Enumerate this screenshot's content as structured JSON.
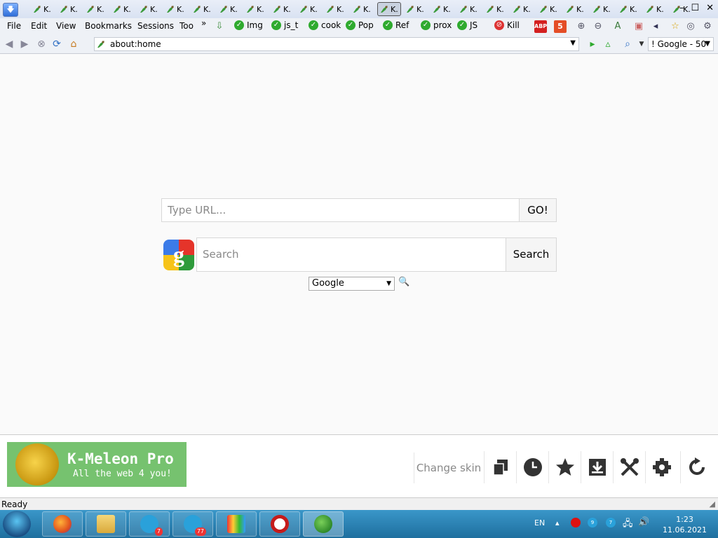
{
  "tabs": [
    {
      "label": "K."
    },
    {
      "label": "K."
    },
    {
      "label": "K."
    },
    {
      "label": "K."
    },
    {
      "label": "K."
    },
    {
      "label": "K."
    },
    {
      "label": "K."
    },
    {
      "label": "K."
    },
    {
      "label": "K."
    },
    {
      "label": "K."
    },
    {
      "label": "K."
    },
    {
      "label": "K."
    },
    {
      "label": "K."
    },
    {
      "label": "K.",
      "active": true
    },
    {
      "label": "K."
    },
    {
      "label": "K."
    },
    {
      "label": "K."
    },
    {
      "label": "K."
    },
    {
      "label": "K."
    },
    {
      "label": "K."
    },
    {
      "label": "K."
    },
    {
      "label": "K."
    },
    {
      "label": "K."
    },
    {
      "label": "K."
    },
    {
      "label": "K."
    }
  ],
  "menu": {
    "file": "File",
    "edit": "Edit",
    "view": "View",
    "bookmarks": "Bookmarks",
    "sessions": "Sessions",
    "tools": "Too",
    "overflow": "»"
  },
  "toggles": {
    "img": "Img",
    "js_t": "js_t",
    "cook": "cook",
    "pop": "Pop",
    "ref": "Ref",
    "prox": "prox",
    "js": "JS",
    "kill": "Kill"
  },
  "badges": {
    "abp": "ABP",
    "html5": "5"
  },
  "address": {
    "url": "about:home"
  },
  "search_engine_box": {
    "value": "! Google - 50"
  },
  "home": {
    "url_placeholder": "Type URL...",
    "go_label": "GO!",
    "search_placeholder": "Search",
    "search_label": "Search",
    "engine": "Google"
  },
  "banner": {
    "title": "K-Meleon Pro",
    "subtitle": "All the web 4 you!"
  },
  "panel": {
    "change_skin": "Change skin"
  },
  "status": {
    "text": "Ready"
  },
  "taskbar": {
    "telegram1_badge": "7",
    "telegram2_badge": "77"
  },
  "tray": {
    "lang": "EN",
    "time": "1:23",
    "date": "11.06.2021",
    "tg_badge1": "9",
    "tg_badge2": "7"
  },
  "colors": {
    "banner": "#76c26f",
    "taskbar": "#2b86b8",
    "check": "#2faa2f"
  }
}
